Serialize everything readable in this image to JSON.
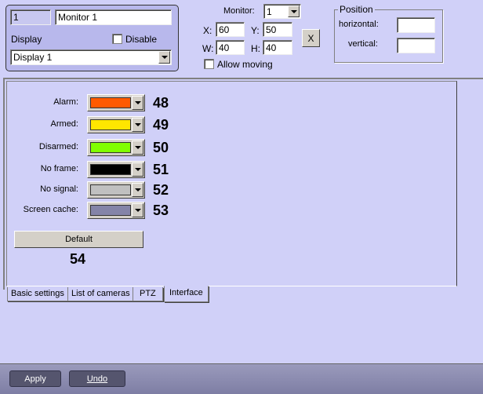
{
  "monitor_box": {
    "id": "1",
    "name": "Monitor 1",
    "display_label": "Display",
    "disable_label": "Disable",
    "display_value": "Display 1"
  },
  "geometry": {
    "monitor_label": "Monitor:",
    "monitor_value": "1",
    "x_label": "X:",
    "x": "60",
    "y_label": "Y:",
    "y": "50",
    "w_label": "W:",
    "w": "40",
    "h_label": "H:",
    "h": "40",
    "clear_label": "X",
    "allow_moving": "Allow moving"
  },
  "position": {
    "title": "Position",
    "horizontal": "horizontal:",
    "horizontal_value": "",
    "vertical": "vertical:",
    "vertical_value": ""
  },
  "colors": [
    {
      "label": "Alarm:",
      "color": "#ff5a00",
      "num": "48"
    },
    {
      "label": "Armed:",
      "color": "#ffe600",
      "num": "49"
    },
    {
      "label": "Disarmed:",
      "color": "#80ff00",
      "num": "50"
    },
    {
      "label": "No frame:",
      "color": "#000000",
      "num": "51"
    },
    {
      "label": "No signal:",
      "color": "#c0c0c0",
      "num": "52"
    },
    {
      "label": "Screen cache:",
      "color": "#8484a8",
      "num": "53"
    }
  ],
  "default_label": "Default",
  "default_num": "54",
  "tabs": [
    "Basic settings",
    "List of cameras",
    "PTZ",
    "Interface"
  ],
  "apply": "Apply",
  "undo": "Undo"
}
